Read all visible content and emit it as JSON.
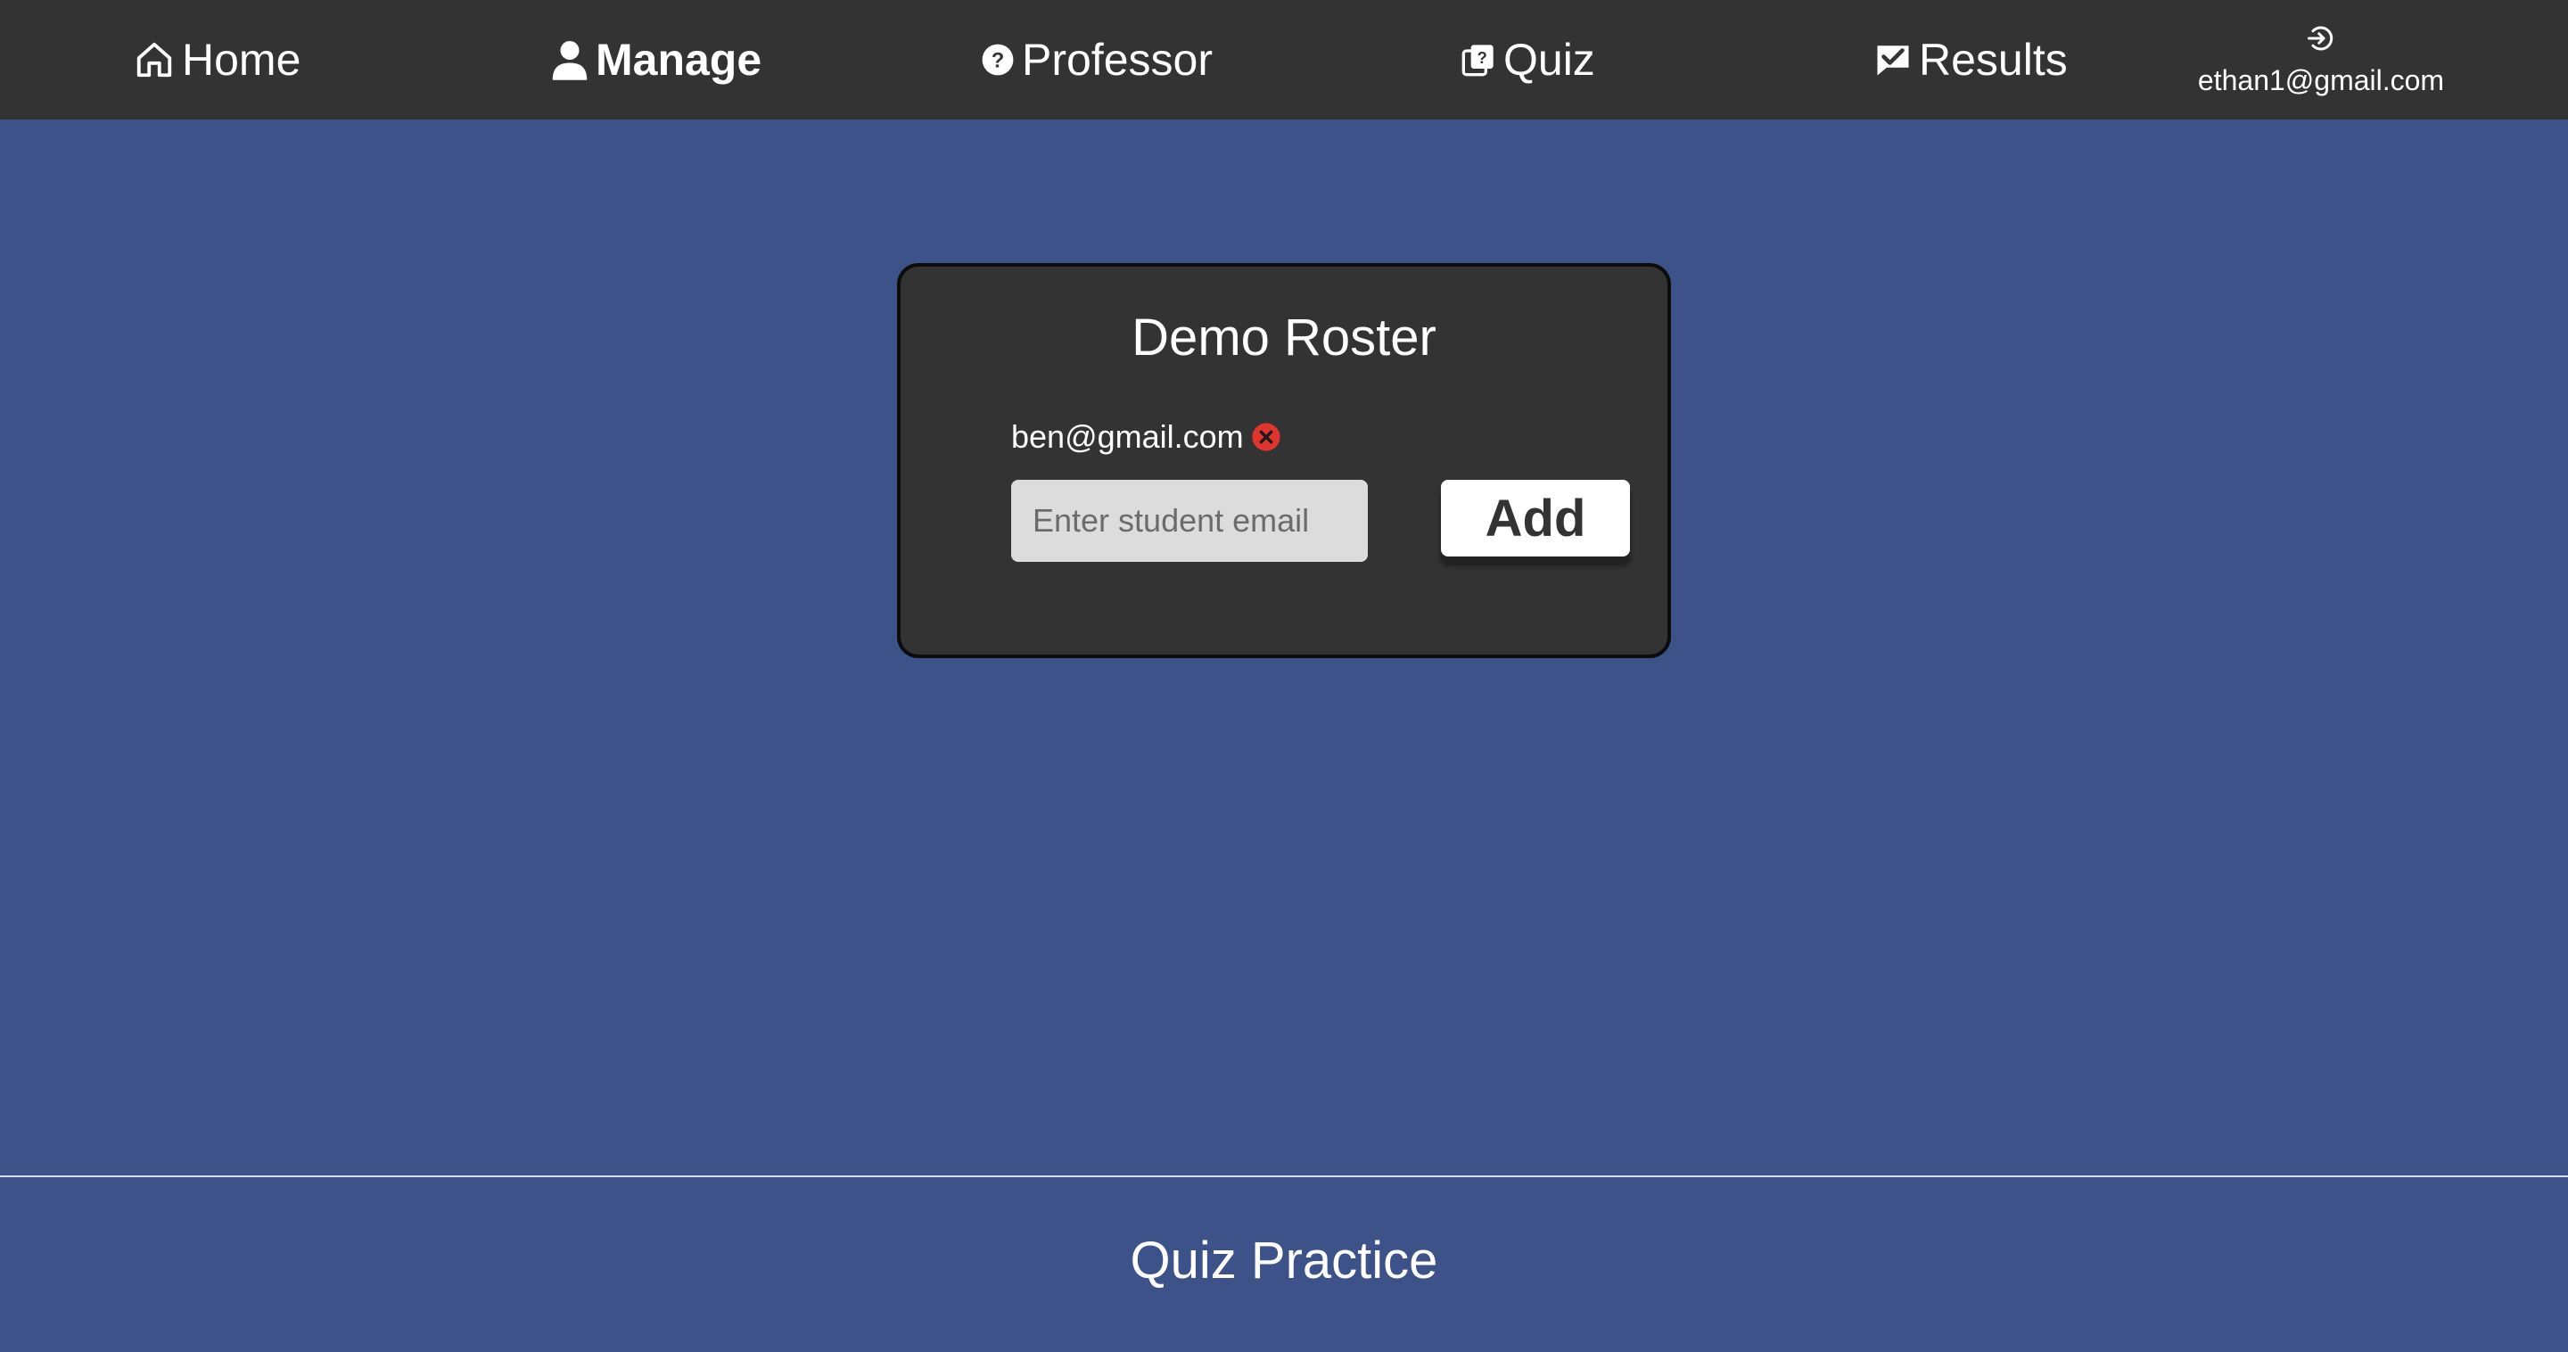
{
  "nav": {
    "items": [
      {
        "label": "Home",
        "icon": "home-icon",
        "active": false
      },
      {
        "label": "Manage",
        "icon": "user-icon",
        "active": true
      },
      {
        "label": "Professor",
        "icon": "question-circle-icon",
        "active": false
      },
      {
        "label": "Quiz",
        "icon": "quiz-stack-icon",
        "active": false
      },
      {
        "label": "Results",
        "icon": "chat-check-icon",
        "active": false
      }
    ],
    "account": {
      "icon": "login-icon",
      "email": "ethan1@gmail.com"
    }
  },
  "roster": {
    "title": "Demo Roster",
    "students": [
      {
        "email": "ben@gmail.com",
        "remove_icon": "remove-circle-icon"
      }
    ],
    "input": {
      "value": "",
      "placeholder": "Enter student email"
    },
    "add_label": "Add"
  },
  "footer": {
    "title": "Quiz Practice"
  },
  "colors": {
    "background": "#3d5289",
    "panel": "#333333",
    "remove": "#e0342f",
    "button": "#ffffff"
  }
}
